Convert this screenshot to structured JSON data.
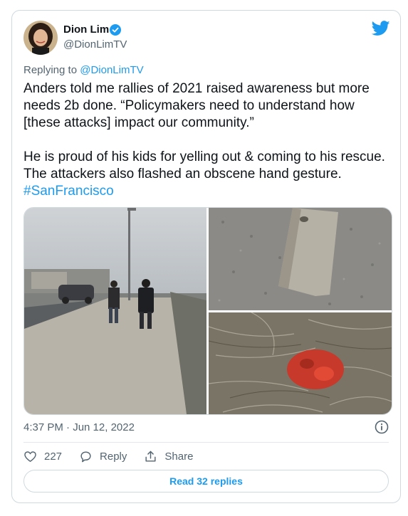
{
  "author": {
    "name": "Dion Lim",
    "handle": "@DionLimTV",
    "verified": true
  },
  "replying": {
    "prefix": "Replying to ",
    "to": "@DionLimTV"
  },
  "tweet": {
    "paragraph1": "Anders told me rallies of 2021 raised awareness but more needs 2b done. “Policymakers need to understand how [these attacks] impact our community.”",
    "paragraph2_text": "He is proud of his kids for yelling out & coming to his rescue. The attackers also flashed an obscene hand gesture. ",
    "hashtag": "#SanFrancisco"
  },
  "timestamp": "4:37 PM · Jun 12, 2022",
  "actions": {
    "likes": "227",
    "reply_label": "Reply",
    "share_label": "Share"
  },
  "read_replies_label": "Read 32 replies",
  "colors": {
    "accent": "#1d9bf0",
    "muted_text": "#536471",
    "border": "#cfd9de"
  },
  "icons": [
    "verified-badge-icon",
    "twitter-bird-icon",
    "info-icon",
    "heart-icon",
    "reply-bubble-icon",
    "share-icon"
  ]
}
